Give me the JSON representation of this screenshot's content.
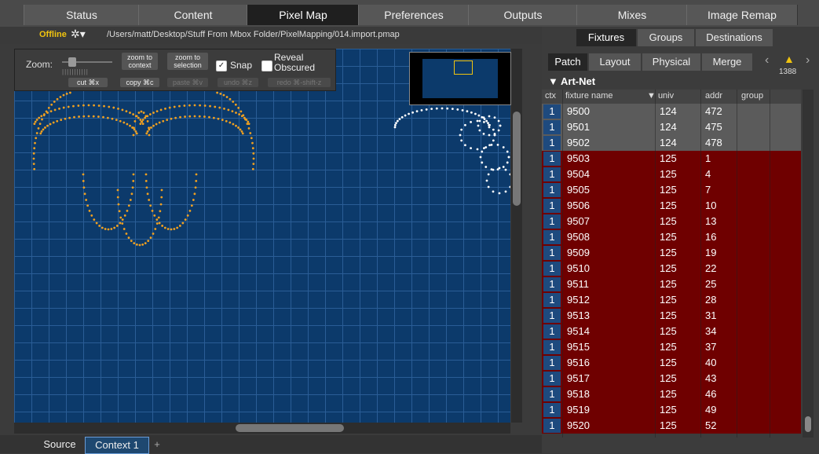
{
  "top_tabs": [
    "Status",
    "Content",
    "Pixel Map",
    "Preferences",
    "Outputs",
    "Mixes",
    "Image Remap"
  ],
  "active_tab": "Pixel Map",
  "status": {
    "offline": "Offline",
    "path": "/Users/matt/Desktop/Stuff From Mbox Folder/PixelMapping/014.import.pmap"
  },
  "toolbar": {
    "zoom_label": "Zoom:",
    "zoom_to_context": "zoom to context",
    "zoom_to_selection": "zoom to selection",
    "snap_label": "Snap",
    "snap_checked": true,
    "reveal_label": "Reveal Obscured",
    "cut": "cut ⌘x",
    "copy": "copy ⌘c",
    "paste": "paste ⌘v",
    "undo": "undo ⌘z",
    "redo": "redo ⌘-shift-z"
  },
  "bottom_tabs": {
    "source": "Source",
    "context": "Context 1",
    "add": "+"
  },
  "right_panel": {
    "top_tabs": [
      "Fixtures",
      "Groups",
      "Destinations"
    ],
    "sub_tabs": [
      "Patch",
      "Layout",
      "Physical",
      "Merge"
    ],
    "warning_count": "1388",
    "group_name": "Art-Net",
    "columns": {
      "ctx": "ctx",
      "name": "fixture name",
      "univ": "▼ univ",
      "addr": "addr",
      "group": "group"
    },
    "rows": [
      {
        "ctx": "1",
        "name": "9500",
        "univ": "124",
        "addr": "472",
        "selected": false
      },
      {
        "ctx": "1",
        "name": "9501",
        "univ": "124",
        "addr": "475",
        "selected": false
      },
      {
        "ctx": "1",
        "name": "9502",
        "univ": "124",
        "addr": "478",
        "selected": false
      },
      {
        "ctx": "1",
        "name": "9503",
        "univ": "125",
        "addr": "1",
        "selected": true
      },
      {
        "ctx": "1",
        "name": "9504",
        "univ": "125",
        "addr": "4",
        "selected": true
      },
      {
        "ctx": "1",
        "name": "9505",
        "univ": "125",
        "addr": "7",
        "selected": true
      },
      {
        "ctx": "1",
        "name": "9506",
        "univ": "125",
        "addr": "10",
        "selected": true
      },
      {
        "ctx": "1",
        "name": "9507",
        "univ": "125",
        "addr": "13",
        "selected": true
      },
      {
        "ctx": "1",
        "name": "9508",
        "univ": "125",
        "addr": "16",
        "selected": true
      },
      {
        "ctx": "1",
        "name": "9509",
        "univ": "125",
        "addr": "19",
        "selected": true
      },
      {
        "ctx": "1",
        "name": "9510",
        "univ": "125",
        "addr": "22",
        "selected": true
      },
      {
        "ctx": "1",
        "name": "9511",
        "univ": "125",
        "addr": "25",
        "selected": true
      },
      {
        "ctx": "1",
        "name": "9512",
        "univ": "125",
        "addr": "28",
        "selected": true
      },
      {
        "ctx": "1",
        "name": "9513",
        "univ": "125",
        "addr": "31",
        "selected": true
      },
      {
        "ctx": "1",
        "name": "9514",
        "univ": "125",
        "addr": "34",
        "selected": true
      },
      {
        "ctx": "1",
        "name": "9515",
        "univ": "125",
        "addr": "37",
        "selected": true
      },
      {
        "ctx": "1",
        "name": "9516",
        "univ": "125",
        "addr": "40",
        "selected": true
      },
      {
        "ctx": "1",
        "name": "9517",
        "univ": "125",
        "addr": "43",
        "selected": true
      },
      {
        "ctx": "1",
        "name": "9518",
        "univ": "125",
        "addr": "46",
        "selected": true
      },
      {
        "ctx": "1",
        "name": "9519",
        "univ": "125",
        "addr": "49",
        "selected": true
      },
      {
        "ctx": "1",
        "name": "9520",
        "univ": "125",
        "addr": "52",
        "selected": true
      }
    ]
  },
  "colors": {
    "selected_row": "#6f0000",
    "canvas": "#0c3a6b",
    "fixture_orange": "#f0a020",
    "fixture_white": "#ffffff",
    "offline": "#f1c40f"
  }
}
